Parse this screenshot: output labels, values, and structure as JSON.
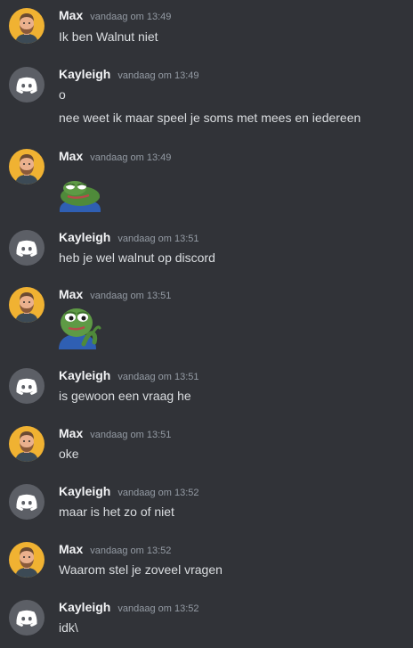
{
  "users": {
    "max": "Max",
    "kayleigh": "Kayleigh"
  },
  "messages": [
    {
      "author": "Max",
      "time": "vandaag om 13:49",
      "lines": [
        "Ik ben Walnut niet"
      ]
    },
    {
      "author": "Kayleigh",
      "time": "vandaag om 13:49",
      "lines": [
        "o",
        "nee weet ik maar speel je soms met mees en iedereen"
      ]
    },
    {
      "author": "Max",
      "time": "vandaag om 13:49",
      "emoji": "pepe-lying-emoji"
    },
    {
      "author": "Kayleigh",
      "time": "vandaag om 13:51",
      "lines": [
        "heb je wel walnut op discord"
      ]
    },
    {
      "author": "Max",
      "time": "vandaag om 13:51",
      "emoji": "pepe-thinking-emoji"
    },
    {
      "author": "Kayleigh",
      "time": "vandaag om 13:51",
      "lines": [
        "is gewoon een vraag he"
      ]
    },
    {
      "author": "Max",
      "time": "vandaag om 13:51",
      "lines": [
        "oke"
      ]
    },
    {
      "author": "Kayleigh",
      "time": "vandaag om 13:52",
      "lines": [
        "maar is het zo of niet"
      ]
    },
    {
      "author": "Max",
      "time": "vandaag om 13:52",
      "lines": [
        "Waarom stel je zoveel vragen"
      ]
    },
    {
      "author": "Kayleigh",
      "time": "vandaag om 13:52",
      "lines": [
        "idk\\"
      ]
    }
  ],
  "colors": {
    "background": "#313338",
    "username": "#f2f3f5",
    "timestamp": "#949ba4",
    "text": "#dbdee1",
    "discord_avatar_bg": "#5c5f66",
    "max_avatar_bg": "#f0b232"
  }
}
